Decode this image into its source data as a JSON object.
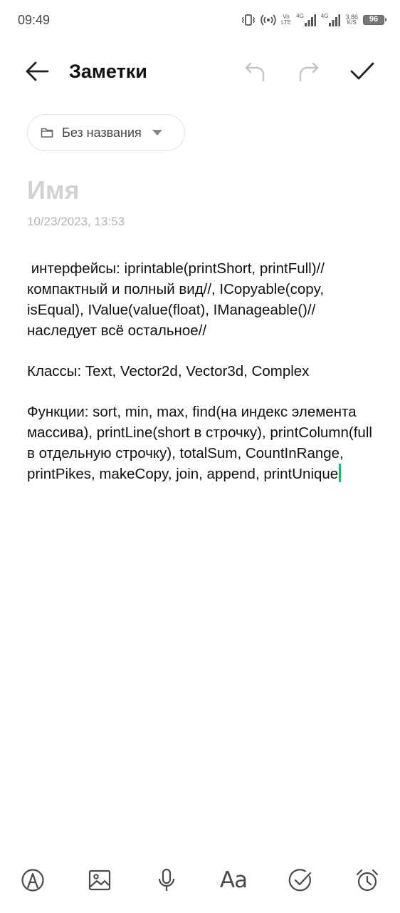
{
  "status_bar": {
    "time": "09:49",
    "net1_top": "Vo",
    "net1_bottom": "LTE",
    "net2_label": "4G",
    "net3_label": "4G",
    "speed_value": "3,86",
    "speed_unit": "K/S",
    "battery": "96"
  },
  "toolbar": {
    "title": "Заметки",
    "icons": [
      "back-arrow-icon",
      "undo-icon",
      "redo-icon",
      "checkmark-icon"
    ]
  },
  "folder": {
    "name": "Без названия",
    "icon": "folder-icon"
  },
  "note": {
    "title_placeholder": "Имя",
    "date": "10/23/2023, 13:53",
    "paragraphs": [
      " интерфейсы: iprintable(printShort, printFull)// компактный и полный вид//, ICopyable(copy, isEqual), IValue(value(float), IManageable()// наследует всё остальное//",
      "Классы: Text, Vector2d, Vector3d, Complex",
      "Функции: sort, min, max, find(на индекс элемента массива), printLine(short в строчку), printColumn(full в отдельную строчку), totalSum, CountInRange, printPikes, makeCopy, join, append, printUnique"
    ]
  },
  "bottom_bar": {
    "format_label": "Aa",
    "icons": [
      "pen-icon",
      "image-icon",
      "microphone-icon",
      "text-format-icon",
      "checklist-icon",
      "alarm-clock-icon"
    ]
  },
  "colors": {
    "accent_caret": "#1db97a",
    "icon_gray": "#4a4a4a",
    "disabled_gray": "#c4c4c4",
    "placeholder_gray": "#d2d2d2"
  }
}
